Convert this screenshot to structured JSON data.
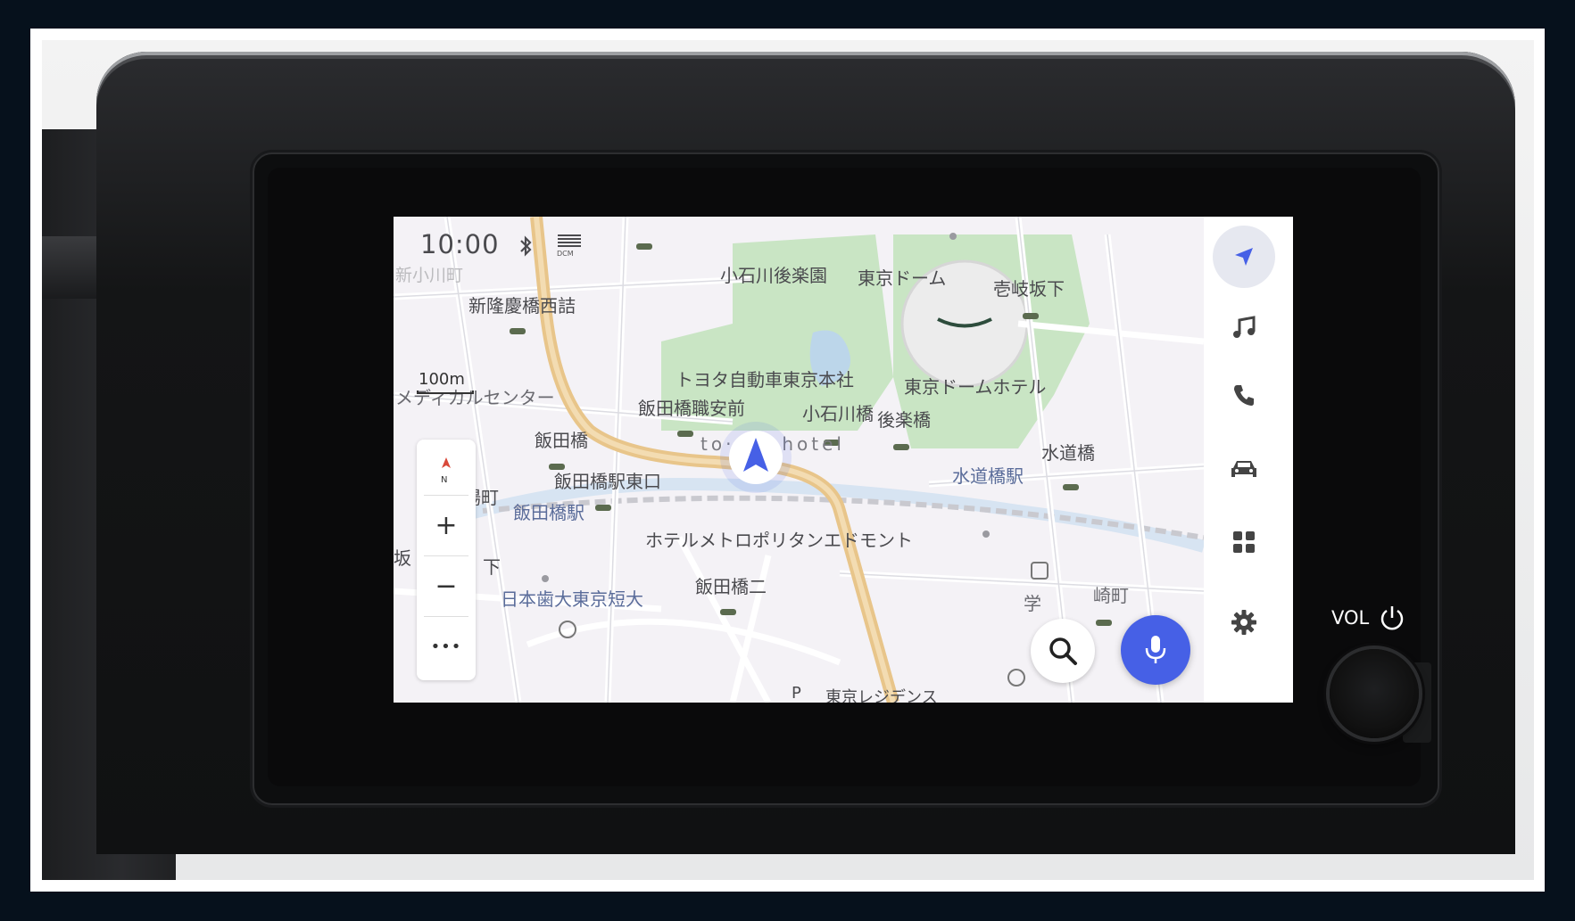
{
  "status_bar": {
    "time": "10:00",
    "bluetooth_icon": "bluetooth-icon",
    "dcm_label": "DCM"
  },
  "map": {
    "labels": [
      {
        "id": "shin-ogawamachi",
        "text": "新小川町"
      },
      {
        "id": "shinryukei-bashi-nishizume",
        "text": "新隆慶橋西詰"
      },
      {
        "id": "koishikawa-korakuen",
        "text": "小石川後楽園"
      },
      {
        "id": "tokyo-dome",
        "text": "東京ドーム"
      },
      {
        "id": "ikizaka-shita",
        "text": "壱岐坂下"
      },
      {
        "id": "toyota-honsha",
        "text": "トヨタ自動車東京本社"
      },
      {
        "id": "tokyo-dome-hotel",
        "text": "東京ドームホテル"
      },
      {
        "id": "medical-center",
        "text": "メディカルセンター"
      },
      {
        "id": "iidabashi-shokuanmae",
        "text": "飯田橋職安前"
      },
      {
        "id": "koishikawa-bashi",
        "text": "小石川橋"
      },
      {
        "id": "korakubashi",
        "text": "後楽橋"
      },
      {
        "id": "iidabashi",
        "text": "飯田橋"
      },
      {
        "id": "suidobashi",
        "text": "水道橋"
      },
      {
        "id": "tokyu-hotel",
        "text": "to·ple·hotel"
      },
      {
        "id": "iidabashi-eki-higashiguchi",
        "text": "飯田橋駅東口"
      },
      {
        "id": "suidobashi-eki",
        "text": "水道橋駅"
      },
      {
        "id": "iidabashi-eki",
        "text": "飯田橋駅"
      },
      {
        "id": "machi-fragment",
        "text": "場町"
      },
      {
        "id": "hotel-metropolitan",
        "text": "ホテルメトロポリタンエドモント"
      },
      {
        "id": "saka-fragment",
        "text": "坂"
      },
      {
        "id": "shita-fragment",
        "text": "下"
      },
      {
        "id": "iidabashi-ni",
        "text": "飯田橋二"
      },
      {
        "id": "nihon-shika-tandai",
        "text": "日本歯大東京短大"
      },
      {
        "id": "gaku-fragment",
        "text": "学"
      },
      {
        "id": "kita-fragment",
        "text": "崎町"
      },
      {
        "id": "residence-fragment",
        "text": "東京レジデンス"
      },
      {
        "id": "parking-p",
        "text": "P"
      }
    ],
    "scale": "100m",
    "compass_label": "N"
  },
  "map_controls": {
    "zoom_in": "+",
    "zoom_out": "−",
    "more": "•••"
  },
  "side_rail": {
    "items": [
      {
        "name": "navigation",
        "icon": "navigation-arrow-icon",
        "active": true
      },
      {
        "name": "music",
        "icon": "music-note-icon"
      },
      {
        "name": "phone",
        "icon": "phone-icon"
      },
      {
        "name": "vehicle",
        "icon": "car-icon"
      },
      {
        "name": "apps",
        "icon": "apps-grid-icon"
      },
      {
        "name": "settings",
        "icon": "gear-icon"
      }
    ]
  },
  "fab": {
    "search_icon": "search-icon",
    "voice_icon": "microphone-icon"
  },
  "hardware": {
    "vol_label": "VOL"
  },
  "colors": {
    "accent_blue": "#4660e6",
    "park_green": "#c9e5c4",
    "route_orange": "#e8c58a",
    "map_bg": "#f4f2f6"
  }
}
